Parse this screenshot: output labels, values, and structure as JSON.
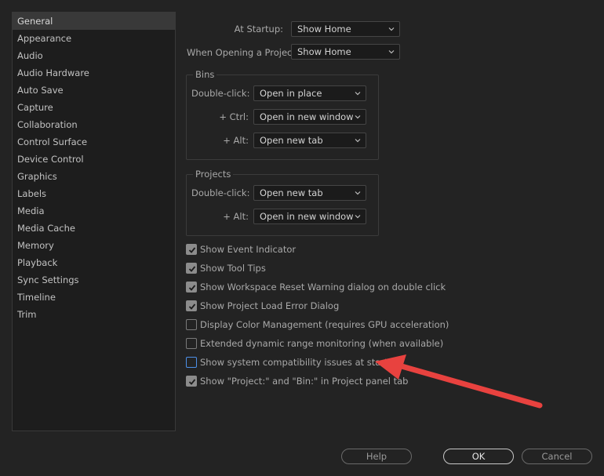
{
  "sidebar": {
    "items": [
      {
        "label": "General",
        "selected": true
      },
      {
        "label": "Appearance"
      },
      {
        "label": "Audio"
      },
      {
        "label": "Audio Hardware"
      },
      {
        "label": "Auto Save"
      },
      {
        "label": "Capture"
      },
      {
        "label": "Collaboration"
      },
      {
        "label": "Control Surface"
      },
      {
        "label": "Device Control"
      },
      {
        "label": "Graphics"
      },
      {
        "label": "Labels"
      },
      {
        "label": "Media"
      },
      {
        "label": "Media Cache"
      },
      {
        "label": "Memory"
      },
      {
        "label": "Playback"
      },
      {
        "label": "Sync Settings"
      },
      {
        "label": "Timeline"
      },
      {
        "label": "Trim"
      }
    ]
  },
  "startup": {
    "at_startup_label": "At Startup:",
    "at_startup_value": "Show Home",
    "opening_label": "When Opening a Project:",
    "opening_value": "Show Home"
  },
  "bins": {
    "title": "Bins",
    "double_click_label": "Double-click:",
    "double_click_value": "Open in place",
    "ctrl_label": "+ Ctrl:",
    "ctrl_value": "Open in new window",
    "alt_label": "+ Alt:",
    "alt_value": "Open new tab"
  },
  "projects": {
    "title": "Projects",
    "double_click_label": "Double-click:",
    "double_click_value": "Open new tab",
    "alt_label": "+ Alt:",
    "alt_value": "Open in new window"
  },
  "checkboxes": [
    {
      "label": "Show Event Indicator",
      "checked": true
    },
    {
      "label": "Show Tool Tips",
      "checked": true
    },
    {
      "label": "Show Workspace Reset Warning dialog on double click",
      "checked": true
    },
    {
      "label": "Show Project Load Error Dialog",
      "checked": true
    },
    {
      "label": "Display Color Management (requires GPU acceleration)",
      "checked": false
    },
    {
      "label": "Extended dynamic range monitoring (when available)",
      "checked": false
    },
    {
      "label": "Show system compatibility issues at startup",
      "checked": false,
      "focused": true
    },
    {
      "label": "Show \"Project:\" and \"Bin:\" in Project panel tab",
      "checked": true
    }
  ],
  "buttons": {
    "help": "Help",
    "ok": "OK",
    "cancel": "Cancel"
  },
  "colors": {
    "background": "#232323",
    "annotation_arrow": "#e8423f",
    "focus": "#4d90e8"
  }
}
